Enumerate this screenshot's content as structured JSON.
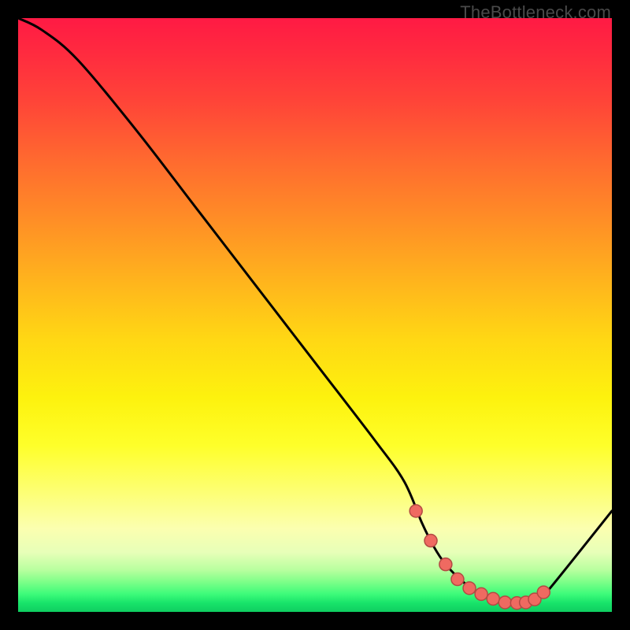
{
  "watermark": "TheBottleneck.com",
  "colors": {
    "background": "#000000",
    "curve": "#000000",
    "marker_fill": "#ef6a61",
    "marker_stroke": "#b34a43"
  },
  "chart_data": {
    "type": "line",
    "title": "",
    "xlabel": "",
    "ylabel": "",
    "xlim": [
      0,
      100
    ],
    "ylim": [
      0,
      100
    ],
    "grid": false,
    "series": [
      {
        "name": "bottleneck-curve",
        "x": [
          0,
          4,
          10,
          20,
          30,
          40,
          50,
          60,
          65,
          68,
          70,
          72,
          75,
          78,
          80,
          82,
          84,
          86,
          88,
          90,
          100
        ],
        "y": [
          100,
          98,
          93,
          81,
          68,
          55,
          42,
          29,
          22,
          15,
          11,
          8,
          5,
          3,
          2,
          1.5,
          1.4,
          1.5,
          2.5,
          4.5,
          17
        ]
      }
    ],
    "markers": {
      "name": "highlighted-points",
      "x": [
        67,
        69.5,
        72,
        74,
        76,
        78,
        80,
        82,
        84,
        85.5,
        87,
        88.5
      ],
      "y": [
        17,
        12,
        8,
        5.5,
        4,
        3,
        2.2,
        1.6,
        1.5,
        1.6,
        2.1,
        3.3
      ]
    }
  }
}
